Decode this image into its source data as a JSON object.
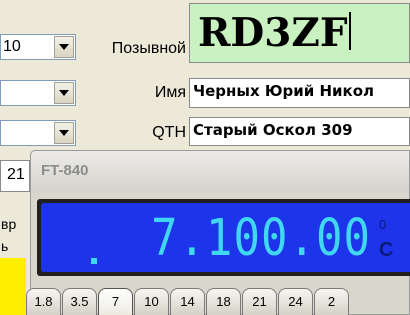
{
  "colors": {
    "background": "#ece9d8",
    "callsign_bg": "#c9f2c0",
    "lcd_bg": "#1d34ea",
    "lcd_text": "#40d8f0",
    "highlight": "#ffee00"
  },
  "form": {
    "combo1": {
      "value": "10",
      "icon": "chevron-down-icon"
    },
    "combo2": {
      "value": "",
      "icon": "chevron-down-icon"
    },
    "combo3": {
      "value": "",
      "icon": "chevron-down-icon"
    },
    "left_partial_field": "21",
    "left_partial_labels": [
      "вр",
      "ь"
    ],
    "callsign_label": "Позывной",
    "callsign_value": "RD3ZF",
    "name_label": "Имя",
    "name_value": "Черных Юрий Никол",
    "qth_label": "QTH",
    "qth_value": "Старый Оскол 309"
  },
  "radio": {
    "title": "FT-840",
    "frequency": "7.100.00",
    "frequency_prefix": ".",
    "side_top": "0",
    "side_bottom": "C",
    "bands": [
      "1.8",
      "3.5",
      "7",
      "10",
      "14",
      "18",
      "21",
      "24",
      "2"
    ],
    "selected_band": "7"
  }
}
